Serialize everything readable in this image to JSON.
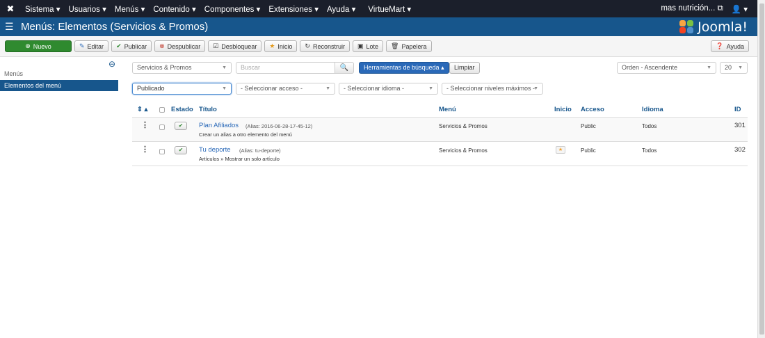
{
  "topnav": {
    "items": [
      "Sistema ▾",
      "Usuarios ▾",
      "Menús ▾",
      "Contenido ▾",
      "Componentes ▾",
      "Extensiones ▾",
      "Ayuda ▾",
      "VirtueMart ▾"
    ],
    "site_link": "mas nutrición... ⧉",
    "user_menu": "👤 ▾"
  },
  "header": {
    "title": "Menús: Elementos (Servicios & Promos)",
    "logo_text": "Joomla!",
    "brand_color": "#17568c"
  },
  "toolbar": {
    "new": "Nuevo",
    "edit": "Editar",
    "publish": "Publicar",
    "unpublish": "Despublicar",
    "unlock": "Desbloquear",
    "home": "Inicio",
    "rebuild": "Reconstruir",
    "batch": "Lote",
    "trash": "Papelera",
    "help": "Ayuda"
  },
  "sidebar": {
    "heading": "Menús",
    "active_item": "Elementos del menú"
  },
  "filters": {
    "menu_select": "Servicios & Promos",
    "search_placeholder": "Buscar",
    "search_tools": "Herramientas de búsqueda ▴",
    "clear": "Limpiar",
    "ordering": "Orden - Ascendente",
    "limit": "20",
    "published": "Publicado",
    "access": "- Seleccionar acceso -",
    "language": "- Seleccionar idioma -",
    "max_levels": "- Seleccionar niveles máximos -"
  },
  "table": {
    "headers": {
      "sort": "⇕ ▴",
      "status": "Estado",
      "title": "Título",
      "menu": "Menú",
      "home": "Inicio",
      "access": "Acceso",
      "language": "Idioma",
      "id": "ID"
    },
    "rows": [
      {
        "title": "Plan Afiliados",
        "alias": "(Alias: 2016-06-28-17-45-12)",
        "type": "Crear un alias a otro elemento del menú",
        "menu": "Servicios & Promos",
        "access": "Public",
        "language": "Todos",
        "id": "301",
        "home": false
      },
      {
        "title": "Tu deporte",
        "alias": "(Alias: tu-deporte)",
        "type": "Artículos » Mostrar un solo artículo",
        "menu": "Servicios & Promos",
        "access": "Public",
        "language": "Todos",
        "id": "302",
        "home": true
      }
    ]
  }
}
